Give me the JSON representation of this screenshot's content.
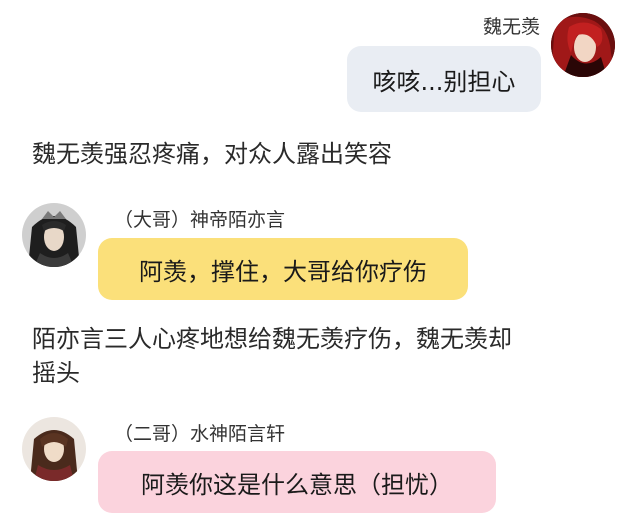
{
  "colors": {
    "bubble_self": "#e9edf3",
    "bubble_yellow": "#fbe07a",
    "bubble_pink": "#fbd3dd"
  },
  "messages": [
    {
      "speaker": "魏无羡",
      "text": "咳咳...别担心",
      "avatar_icon": "red-haired-man-avatar"
    },
    {
      "speaker": "（大哥）神帝陌亦言",
      "text": "阿羡，撑住，大哥给你疗伤",
      "avatar_icon": "dark-crowned-man-avatar"
    },
    {
      "speaker": "（二哥）水神陌言轩",
      "text": "阿羡你这是什么意思（担忧）",
      "avatar_icon": "long-haired-man-avatar"
    }
  ],
  "narrations": [
    {
      "lines": [
        "魏无羡强忍疼痛，对众人露出笑容"
      ]
    },
    {
      "lines": [
        "陌亦言三人心疼地想给魏无羡疗伤，魏无羡却",
        "摇头"
      ]
    }
  ]
}
